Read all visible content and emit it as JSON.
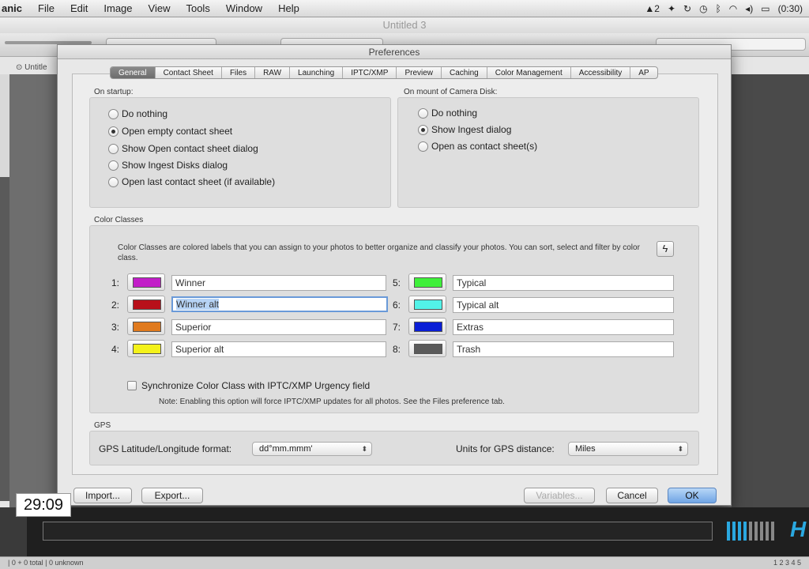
{
  "menubar": {
    "app_name": "anic",
    "menus": [
      "File",
      "Edit",
      "Image",
      "View",
      "Tools",
      "Window",
      "Help"
    ],
    "status": {
      "notification_count": "2",
      "battery": "(0:30)"
    }
  },
  "app_window": {
    "title": "Untitled 3",
    "doc_tab": "Untitle"
  },
  "dialog": {
    "title": "Preferences",
    "tabs": [
      "General",
      "Contact Sheet",
      "Files",
      "RAW",
      "Launching",
      "IPTC/XMP",
      "Preview",
      "Caching",
      "Color Management",
      "Accessibility",
      "AP"
    ],
    "active_tab": "General",
    "on_startup": {
      "label": "On startup:",
      "options": [
        "Do nothing",
        "Open empty contact sheet",
        "Show Open contact sheet dialog",
        "Show Ingest Disks dialog",
        "Open last contact sheet (if available)"
      ],
      "selected": 1
    },
    "on_mount": {
      "label": "On mount of Camera Disk:",
      "options": [
        "Do nothing",
        "Show Ingest dialog",
        "Open as contact sheet(s)"
      ],
      "selected": 1
    },
    "color_classes": {
      "label": "Color Classes",
      "description": "Color Classes are colored labels that you can assign to your photos to better organize and classify your photos.  You can sort, select and filter by color class.",
      "items": [
        {
          "num": "1:",
          "color": "#c21ec8",
          "name": "Winner"
        },
        {
          "num": "2:",
          "color": "#b8101a",
          "name": "Winner alt"
        },
        {
          "num": "3:",
          "color": "#e07a1e",
          "name": "Superior"
        },
        {
          "num": "4:",
          "color": "#f4f21a",
          "name": "Superior alt"
        },
        {
          "num": "5:",
          "color": "#3ef03a",
          "name": "Typical"
        },
        {
          "num": "6:",
          "color": "#52f2e8",
          "name": "Typical alt"
        },
        {
          "num": "7:",
          "color": "#0a1ed6",
          "name": "Extras"
        },
        {
          "num": "8:",
          "color": "#5a5a5a",
          "name": "Trash"
        }
      ],
      "sync_label": "Synchronize Color Class with IPTC/XMP Urgency field",
      "sync_checked": false,
      "note": "Note: Enabling this option will force IPTC/XMP updates for all photos. See the Files preference tab."
    },
    "gps": {
      "label": "GPS",
      "format_label": "GPS Latitude/Longitude format:",
      "format_value": "dd°mm.mmm'",
      "units_label": "Units for GPS distance:",
      "units_value": "Miles"
    },
    "buttons": {
      "import": "Import...",
      "export": "Export...",
      "variables": "Variables...",
      "cancel": "Cancel",
      "ok": "OK"
    }
  },
  "video": {
    "timestamp": "29:09"
  },
  "statusbar": {
    "left": "| 0 + 0 total | 0 unknown",
    "pages": "1 2 3 4 5"
  }
}
